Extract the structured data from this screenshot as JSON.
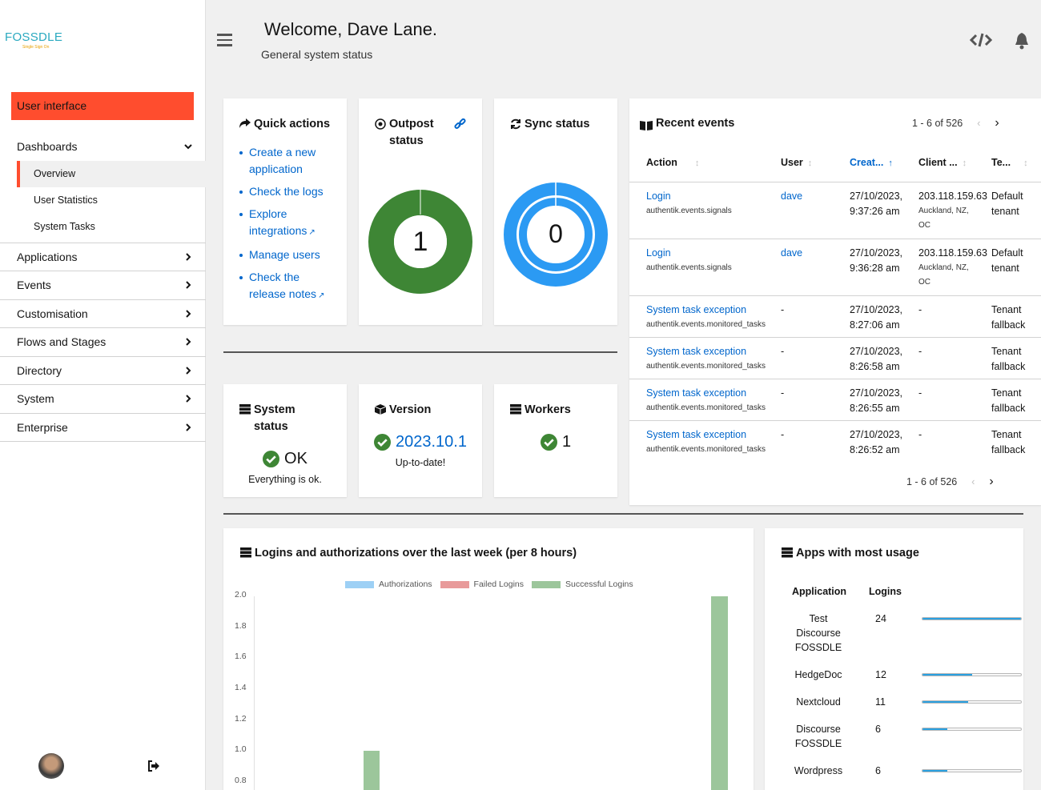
{
  "sidebar": {
    "logo_text": "FOSSDLE",
    "logo_subtitle": "Single Sign On",
    "ui_button": "User interface",
    "dashboards": "Dashboards",
    "dashboards_items": [
      "Overview",
      "User Statistics",
      "System Tasks"
    ],
    "sections": [
      "Applications",
      "Events",
      "Customisation",
      "Flows and Stages",
      "Directory",
      "System",
      "Enterprise"
    ]
  },
  "header": {
    "welcome": "Welcome, Dave Lane.",
    "subtitle": "General system status"
  },
  "quick_actions": {
    "title": "Quick actions",
    "links": [
      "Create a new application",
      "Check the logs",
      "Explore integrations",
      "Manage users",
      "Check the release notes"
    ]
  },
  "outpost": {
    "title": "Outpost status",
    "value": "1"
  },
  "sync": {
    "title": "Sync status",
    "value": "0"
  },
  "system_status": {
    "title": "System status",
    "value": "OK",
    "detail": "Everything is ok."
  },
  "version": {
    "title": "Version",
    "value": "2023.10.1",
    "detail": "Up-to-date!"
  },
  "workers": {
    "title": "Workers",
    "value": "1"
  },
  "recent_events": {
    "title": "Recent events",
    "pager": "1 - 6 of 526",
    "columns": [
      "Action",
      "User",
      "Creat...",
      "Client ...",
      "Te..."
    ],
    "rows": [
      {
        "action": "Login",
        "app": "authentik.events.signals",
        "user": "dave",
        "date": "27/10/2023,",
        "time": "9:37:26 am",
        "client": "203.118.159.63",
        "geo": "Auckland, NZ,",
        "geo2": "OC",
        "tenant": "Default",
        "tenant2": "tenant"
      },
      {
        "action": "Login",
        "app": "authentik.events.signals",
        "user": "dave",
        "date": "27/10/2023,",
        "time": "9:36:28 am",
        "client": "203.118.159.63",
        "geo": "Auckland, NZ,",
        "geo2": "OC",
        "tenant": "Default",
        "tenant2": "tenant"
      },
      {
        "action": "System task exception",
        "app": "authentik.events.monitored_tasks",
        "user": "-",
        "date": "27/10/2023,",
        "time": "8:27:06 am",
        "client": "-",
        "geo": "",
        "geo2": "",
        "tenant": "Tenant",
        "tenant2": "fallback"
      },
      {
        "action": "System task exception",
        "app": "authentik.events.monitored_tasks",
        "user": "-",
        "date": "27/10/2023,",
        "time": "8:26:58 am",
        "client": "-",
        "geo": "",
        "geo2": "",
        "tenant": "Tenant",
        "tenant2": "fallback"
      },
      {
        "action": "System task exception",
        "app": "authentik.events.monitored_tasks",
        "user": "-",
        "date": "27/10/2023,",
        "time": "8:26:55 am",
        "client": "-",
        "geo": "",
        "geo2": "",
        "tenant": "Tenant",
        "tenant2": "fallback"
      },
      {
        "action": "System task exception",
        "app": "authentik.events.monitored_tasks",
        "user": "-",
        "date": "27/10/2023,",
        "time": "8:26:52 am",
        "client": "-",
        "geo": "",
        "geo2": "",
        "tenant": "Tenant",
        "tenant2": "fallback"
      }
    ]
  },
  "logins_chart": {
    "title": "Logins and authorizations over the last week (per 8 hours)"
  },
  "chart_data": {
    "type": "bar",
    "series": [
      {
        "name": "Authorizations",
        "color": "#9dd0f5",
        "values": []
      },
      {
        "name": "Failed Logins",
        "color": "#e89a9a",
        "values": []
      },
      {
        "name": "Successful Logins",
        "color": "#9cc69b",
        "values": [
          1.0,
          2.0
        ]
      }
    ],
    "yticks": [
      "2.0",
      "1.8",
      "1.6",
      "1.4",
      "1.2",
      "1.0",
      "0.8"
    ],
    "ylim": [
      0,
      2.0
    ]
  },
  "apps_usage": {
    "title": "Apps with most usage",
    "col_app": "Application",
    "col_logins": "Logins",
    "rows": [
      {
        "name": "Test Discourse FOSSDLE",
        "logins": "24",
        "fraction": 1.0
      },
      {
        "name": "HedgeDoc",
        "logins": "12",
        "fraction": 0.5
      },
      {
        "name": "Nextcloud",
        "logins": "11",
        "fraction": 0.46
      },
      {
        "name": "Discourse FOSSDLE",
        "logins": "6",
        "fraction": 0.25
      },
      {
        "name": "Wordpress",
        "logins": "6",
        "fraction": 0.25
      }
    ]
  }
}
